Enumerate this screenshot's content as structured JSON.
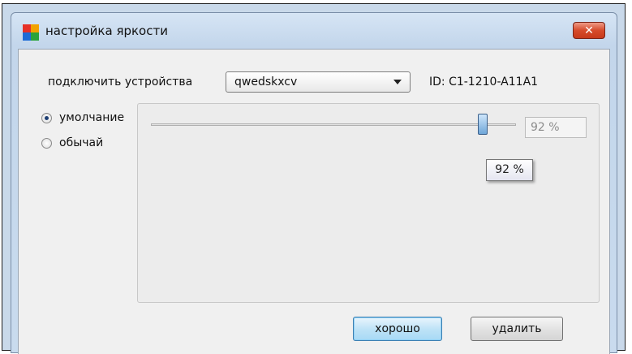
{
  "window": {
    "title": "настройка яркости",
    "close_label": "✕"
  },
  "device": {
    "label": "подключить устройства",
    "selected": "qwedskxcv",
    "id_text": "ID: C1-1210-A11A1"
  },
  "modes": [
    {
      "label": "умолчание",
      "checked": true
    },
    {
      "label": "обычай",
      "checked": false
    }
  ],
  "brightness": {
    "value": 92,
    "value_text": "92 %",
    "tooltip_text": "92 %"
  },
  "buttons": {
    "ok_label": "хорошо",
    "delete_label": "удалить"
  },
  "colors": {
    "close_button": "#d64b2b",
    "ok_button": "#bfe3f7",
    "window_frame": "#c9dbee"
  }
}
